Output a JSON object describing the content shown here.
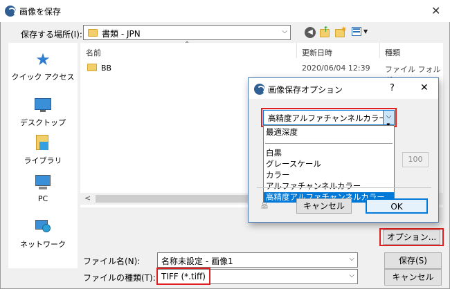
{
  "window": {
    "title": "画像を保存",
    "close_label": "✕"
  },
  "toolbar": {
    "location_label": "保存する場所(I):",
    "location_value": "書類 - JPN"
  },
  "nav": {
    "items": [
      {
        "label": "クイック アクセス",
        "icon": "star-icon"
      },
      {
        "label": "デスクトップ",
        "icon": "desktop-icon"
      },
      {
        "label": "ライブラリ",
        "icon": "library-icon"
      },
      {
        "label": "PC",
        "icon": "pc-icon"
      },
      {
        "label": "ネットワーク",
        "icon": "network-icon"
      }
    ]
  },
  "files": {
    "columns": [
      "名前",
      "更新日時",
      "種類"
    ],
    "rows": [
      {
        "name": "BB",
        "date": "2020/06/04 12:39",
        "type": "ファイル フォルダー"
      }
    ]
  },
  "bottom": {
    "filename_label": "ファイル名(N):",
    "filename_value": "名称未設定 - 画像1",
    "filetype_label": "ファイルの種類(T):",
    "filetype_value": "TIFF (*.tiff)",
    "save_label": "保存(S)",
    "cancel_label": "キャンセル",
    "options_label": "オプション..."
  },
  "options_dialog": {
    "title": "画像保存オプション",
    "help_label": "?",
    "close_label": "✕",
    "selected": "高精度アルファチャンネルカラー",
    "list": [
      "最適深度",
      "白黒",
      "グレースケール",
      "カラー",
      "アルファチャンネルカラー",
      "高精度アルファチャンネルカラー"
    ],
    "number_value": "100",
    "cancel_label": "キャンセル",
    "ok_label": "OK",
    "hidden_label_fragment": "品"
  },
  "colors": {
    "accent": "#0078d7",
    "highlight": "#e02020"
  }
}
